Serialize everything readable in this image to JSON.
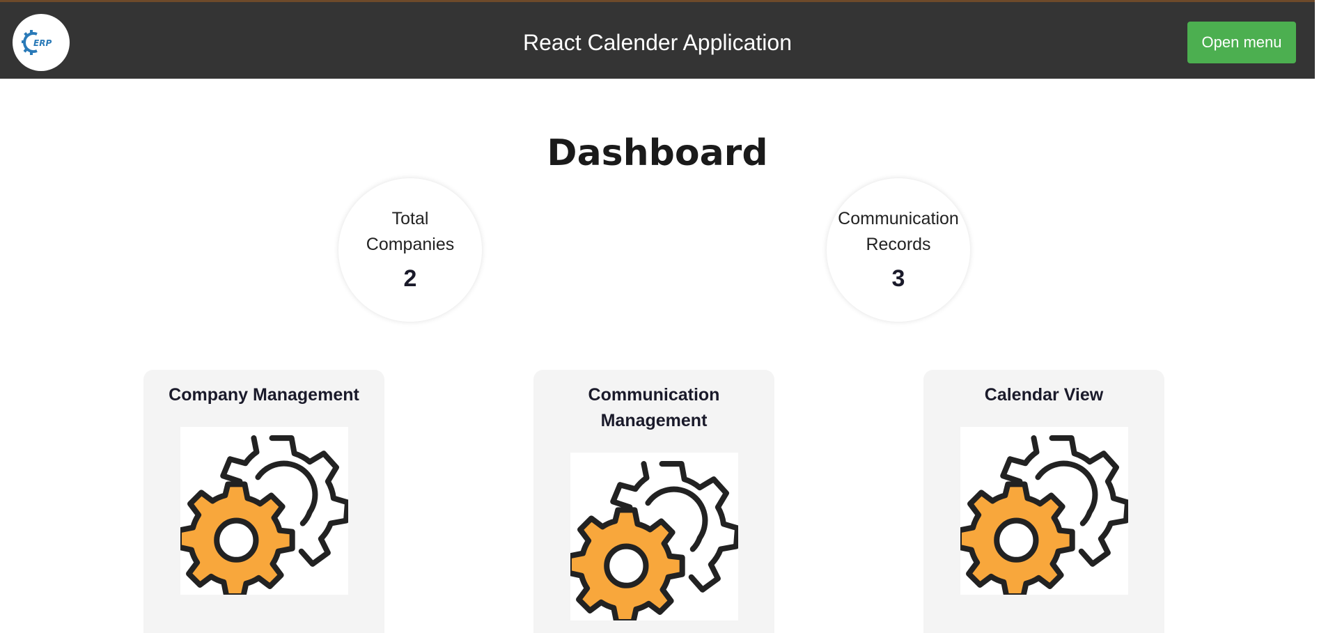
{
  "header": {
    "logo_text": "ERP",
    "title": "React Calender Application",
    "menu_button_label": "Open menu"
  },
  "dashboard": {
    "title": "Dashboard",
    "stats": [
      {
        "label": "Total Companies",
        "value": "2"
      },
      {
        "label": "Communication Records",
        "value": "3"
      }
    ],
    "cards": [
      {
        "title": "Company Management",
        "icon": "gears-icon"
      },
      {
        "title": "Communication Management",
        "icon": "gears-icon"
      },
      {
        "title": "Calendar View",
        "icon": "gears-icon"
      }
    ]
  },
  "colors": {
    "header_bg": "#343434",
    "menu_button": "#4caf50",
    "gear_orange": "#f8a73c",
    "card_bg": "#f4f4f4"
  }
}
